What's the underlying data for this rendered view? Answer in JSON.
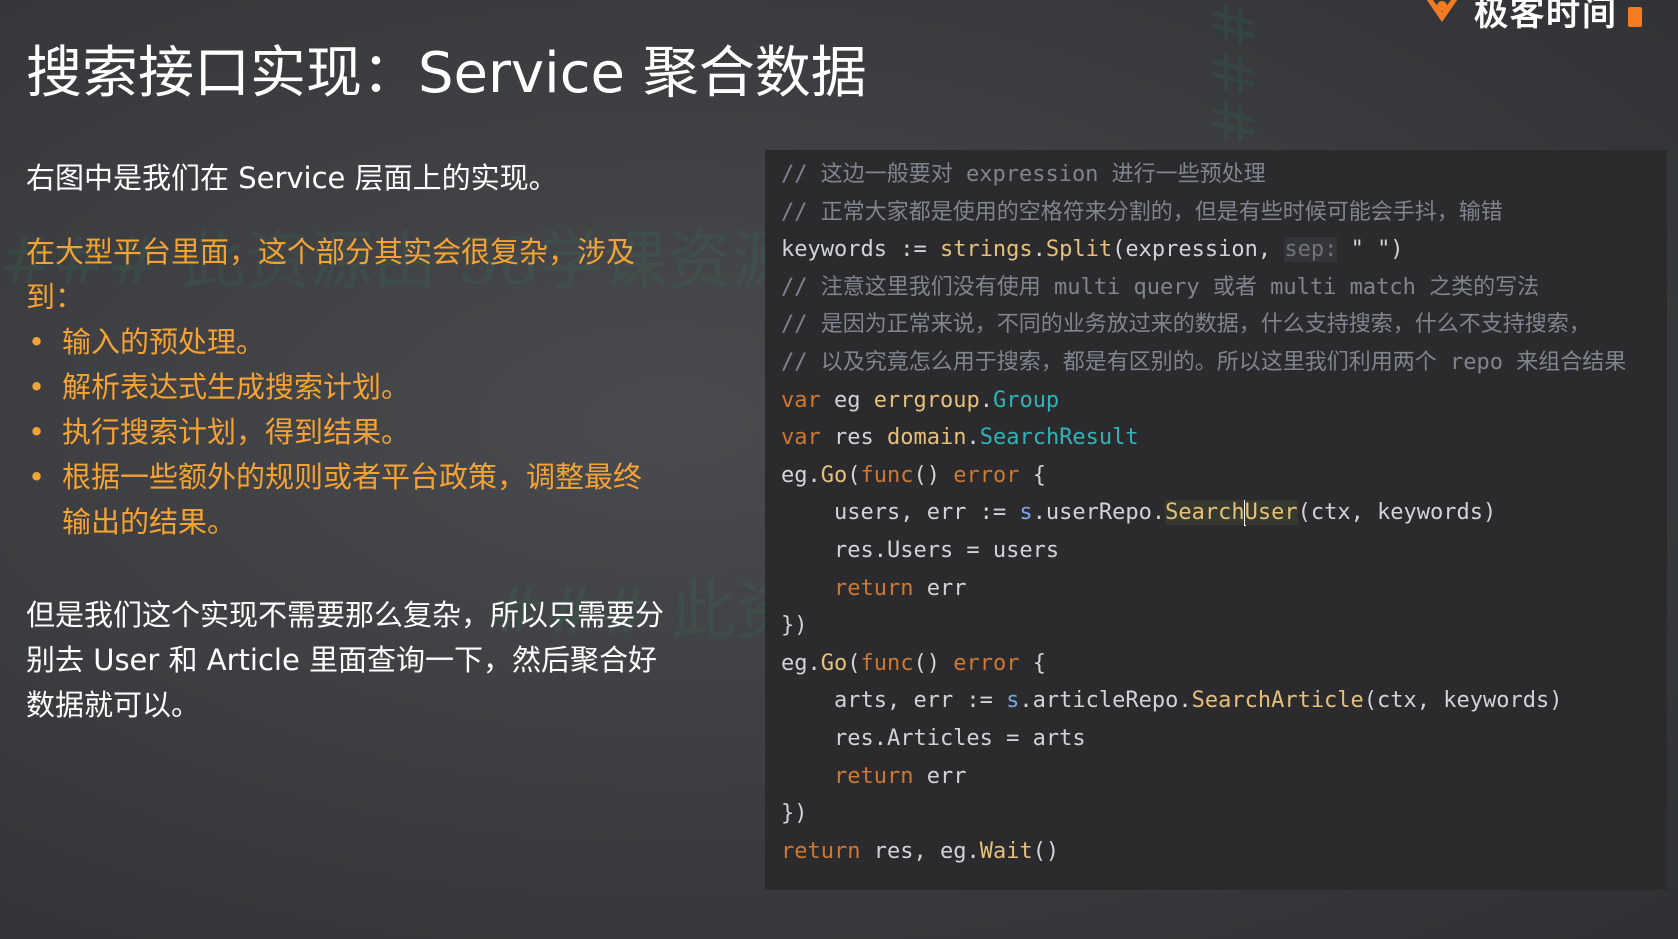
{
  "brand": {
    "name": "极客时间"
  },
  "title": "搜索接口实现：Service 聚合数据",
  "left": {
    "intro": "右图中是我们在 Service 层面上的实现。",
    "complex_intro": "在大型平台里面，这个部分其实会很复杂，涉及到：",
    "bullets": [
      "输入的预处理。",
      "解析表达式生成搜索计划。",
      "执行搜索计划，得到结果。",
      "根据一些额外的规则或者平台政策，调整最终输出的结果。"
    ],
    "bullet_glyph": "•",
    "conclusion": "但是我们这个实现不需要那么复杂，所以只需要分别去 User 和 Article 里面查询一下，然后聚合好数据就可以。"
  },
  "code": {
    "comments": [
      "// 这边一般要对 expression 进行一些预处理",
      "// 正常大家都是使用的空格符来分割的，但是有些时候可能会手抖，输错",
      "// 注意这里我们没有使用 multi query 或者 multi match 之类的写法",
      "// 是因为正常来说，不同的业务放过来的数据，什么支持搜索，什么不支持搜索，",
      "// 以及究竟怎么用于搜索，都是有区别的。所以这里我们利用两个 repo 来组合结果"
    ],
    "keywords_line": {
      "lhs": "keywords := ",
      "pkg": "strings",
      "func": "Split",
      "args_open": "(expression, ",
      "hint": "sep:",
      "arg2": " \" \")"
    },
    "var_eg": {
      "kw": "var",
      "name": " eg ",
      "pkg": "errgroup",
      "type": "Group"
    },
    "var_res": {
      "kw": "var",
      "name": " res ",
      "pkg": "domain",
      "type": "SearchResult"
    },
    "go_open": {
      "recv": "eg.",
      "fn": "Go",
      "p1": "(",
      "kw_func": "func",
      "p2": "() ",
      "kw_error": "error",
      "p3": " {"
    },
    "users_line": {
      "lhs": "    users, err := ",
      "s": "s",
      "repo": ".userRepo.",
      "fn_a": "Search",
      "fn_b": "User",
      "args": "(ctx, keywords)"
    },
    "res_users": "    res.Users = users",
    "return_err": {
      "kw": "return",
      "rest": " err"
    },
    "close": "})",
    "arts_line": {
      "lhs": "    arts, err := ",
      "s": "s",
      "repo": ".articleRepo.",
      "fn": "SearchArticle",
      "args": "(ctx, keywords)"
    },
    "res_articles": "    res.Articles = arts",
    "final_return": {
      "kw": "return",
      "rest": " res, eg.",
      "fn": "Wait",
      "tail": "()"
    }
  },
  "watermark": {
    "line1": "### 此资源由 58学课资源站 收集整理 ###",
    "line2": "### 此资源由 58学课资源站 收集整",
    "line3": "### 源站 58学课 ###"
  },
  "colors": {
    "accent_orange": "#f4a233",
    "code_bg": "#2b2b2d",
    "keyword": "#cc7832",
    "type": "#2fb3b8",
    "func": "#e6c07b"
  }
}
